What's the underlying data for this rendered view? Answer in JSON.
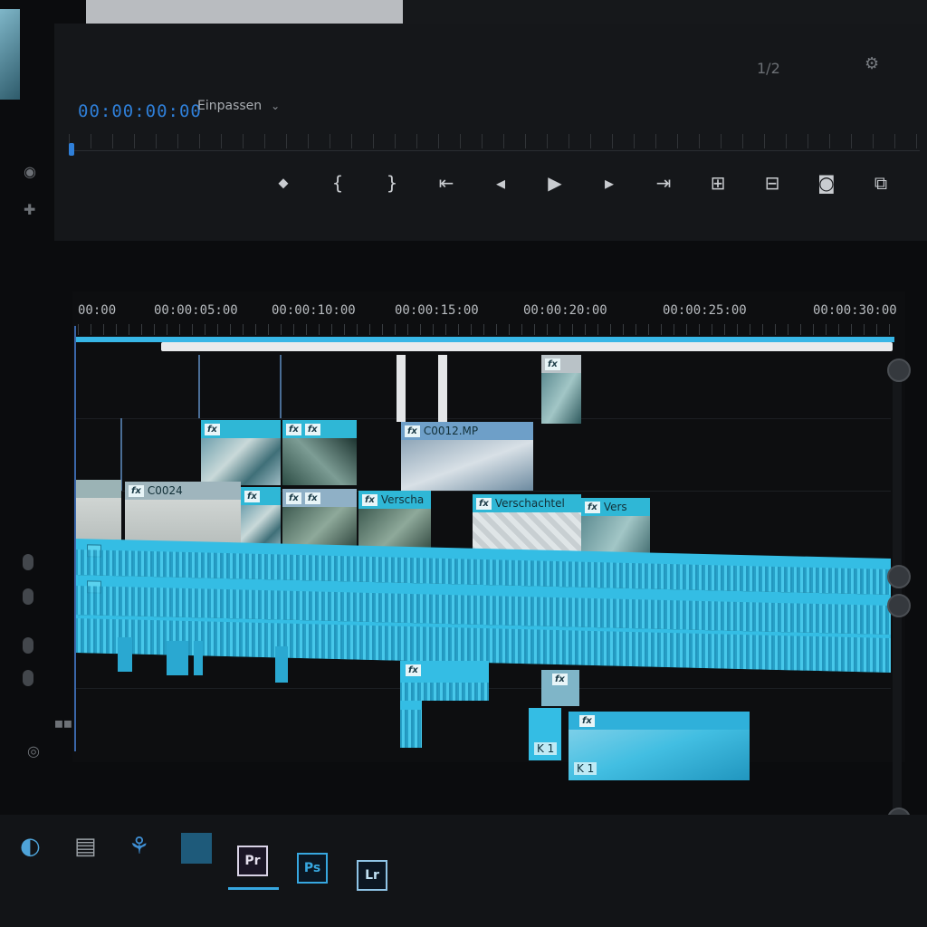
{
  "monitor": {
    "timecode": "00:00:00:00",
    "fit": "Einpassen",
    "zoom_fraction": "1/2"
  },
  "transport": {
    "buttons": [
      {
        "name": "marker-icon",
        "glyph": "⬥"
      },
      {
        "name": "mark-in-icon",
        "glyph": "{"
      },
      {
        "name": "mark-out-icon",
        "glyph": "}"
      },
      {
        "name": "go-to-in-icon",
        "glyph": "⇤"
      },
      {
        "name": "step-back-icon",
        "glyph": "◂"
      },
      {
        "name": "play-icon",
        "glyph": "▶"
      },
      {
        "name": "step-forward-icon",
        "glyph": "▸"
      },
      {
        "name": "go-to-out-icon",
        "glyph": "⇥"
      },
      {
        "name": "lift-icon",
        "glyph": "⊞"
      },
      {
        "name": "extract-icon",
        "glyph": "⊟"
      },
      {
        "name": "export-frame-icon",
        "glyph": "◙"
      },
      {
        "name": "compare-icon",
        "glyph": "⧉"
      }
    ]
  },
  "ruler": {
    "labels": [
      "00:00",
      "00:00:05:00",
      "00:00:10:00",
      "00:00:15:00",
      "00:00:20:00",
      "00:00:25:00",
      "00:00:30:00"
    ]
  },
  "clips": {
    "v2_c0012": "C0012.MP",
    "v1_c0024": "C0024",
    "v1_nest_a": "Verscha",
    "v1_nest_b": "Verschachtel",
    "v1_nest_c": "Vers",
    "fx": "fx"
  },
  "audio_labels": {
    "k1_a": "K 1",
    "k1_b": "K 1"
  },
  "taskbar": {
    "pr": "Pr",
    "ps": "Ps",
    "lr": "Lr"
  },
  "colors": {
    "accent": "#37b6e6",
    "timecode": "#2f7fd8",
    "background": "#0b0c0e"
  }
}
